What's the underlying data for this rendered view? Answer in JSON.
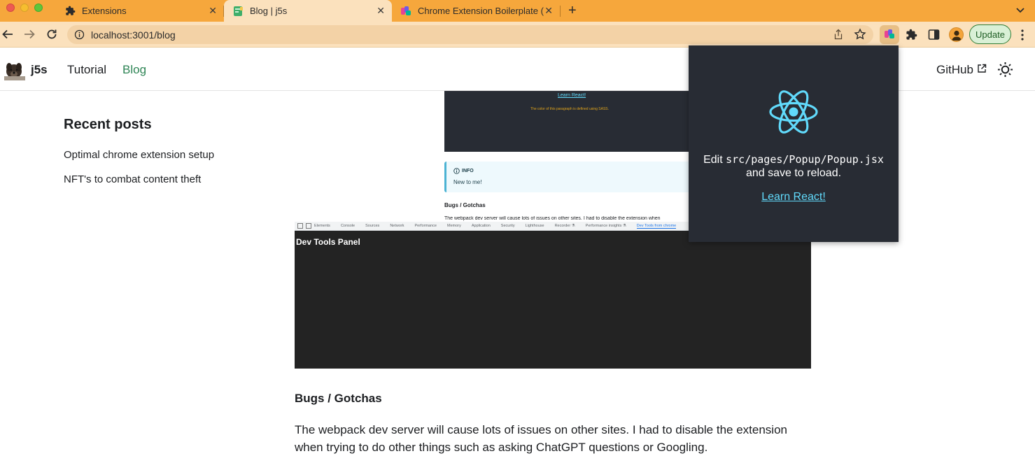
{
  "browser": {
    "tabs": [
      {
        "title": "Extensions",
        "icon": "puzzle-icon",
        "active": false
      },
      {
        "title": "Blog | j5s",
        "icon": "site-favicon",
        "active": true
      },
      {
        "title": "Chrome Extension Boilerplate (",
        "icon": "colorful-extension-favicon",
        "active": false
      }
    ],
    "url": "localhost:3001/blog",
    "update_label": "Update",
    "colors": {
      "tabstrip": "#f6a73c",
      "toolbar": "#fbe1bd",
      "update_green": "#2f7d35"
    }
  },
  "site": {
    "name": "j5s",
    "nav": {
      "tutorial": "Tutorial",
      "blog": "Blog",
      "github": "GitHub"
    },
    "accent": "#2e8555"
  },
  "sidebar": {
    "title": "Recent posts",
    "items": [
      {
        "label": "Optimal chrome extension setup"
      },
      {
        "label": "NFT's to combat content theft"
      }
    ]
  },
  "article": {
    "screenshot": {
      "learn_react": "Learn React!",
      "sass_note": "The color of this paragraph is defined using SASS.",
      "info_title": "INFO",
      "info_text": "New to me!",
      "mini_heading": "Bugs / Gotchas",
      "mini_para": "The webpack dev server will cause lots of issues on other sites. I had to disable the extension when",
      "devtools_tabs": [
        "Elements",
        "Console",
        "Sources",
        "Network",
        "Performance",
        "Memory",
        "Application",
        "Security",
        "Lighthouse",
        "Recorder ⚗",
        "Performance insights ⚗",
        "Dev Tools from chrome"
      ],
      "devtools_panel_title": "Dev Tools Panel"
    },
    "section_heading": "Bugs / Gotchas",
    "paragraph": "The webpack dev server will cause lots of issues on other sites. I had to disable the extension when trying to do other things such as asking ChatGPT questions or Googling."
  },
  "popup": {
    "edit_prefix": "Edit ",
    "edit_path": "src/pages/Popup/Popup.jsx",
    "save_text": "and save to reload.",
    "link": "Learn React!",
    "colors": {
      "background": "#282c34",
      "react": "#61dafb"
    }
  }
}
